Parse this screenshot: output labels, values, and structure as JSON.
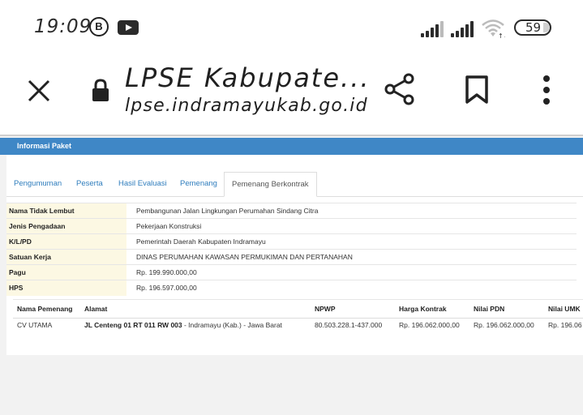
{
  "status_bar": {
    "time": "19:09",
    "b_label": "B",
    "battery": "59"
  },
  "browser": {
    "title": "LPSE Kabupate...",
    "url": "lpse.indramayukab.go.id"
  },
  "page": {
    "header": "Informasi Paket",
    "tabs": [
      {
        "label": "Pengumuman"
      },
      {
        "label": "Peserta"
      },
      {
        "label": "Hasil Evaluasi"
      },
      {
        "label": "Pemenang"
      },
      {
        "label": "Pemenang Berkontrak"
      }
    ],
    "info_rows": [
      {
        "label": "Nama Tidak Lembut",
        "value": "Pembangunan Jalan Lingkungan Perumahan Sindang Citra"
      },
      {
        "label": "Jenis Pengadaan",
        "value": "Pekerjaan Konstruksi"
      },
      {
        "label": "K/L/PD",
        "value": "Pemerintah Daerah Kabupaten Indramayu"
      },
      {
        "label": "Satuan Kerja",
        "value": "DINAS PERUMAHAN KAWASAN PERMUKIMAN DAN PERTANAHAN"
      },
      {
        "label": "Pagu",
        "value": "Rp. 199.990.000,00"
      },
      {
        "label": "HPS",
        "value": "Rp. 196.597.000,00"
      }
    ],
    "winner_table": {
      "headers": [
        "Nama Pemenang",
        "Alamat",
        "NPWP",
        "Harga Kontrak",
        "Nilai PDN",
        "Nilai UMK"
      ],
      "row": {
        "nama": "CV UTAMA",
        "alamat_bold": "JL Centeng 01 RT 011 RW 003",
        "alamat_rest": " - Indramayu (Kab.) - Jawa Barat",
        "npwp": "80.503.228.1-437.000",
        "harga": "Rp. 196.062.000,00",
        "pdn": "Rp. 196.062.000,00",
        "umk": "Rp. 196.06"
      }
    }
  }
}
